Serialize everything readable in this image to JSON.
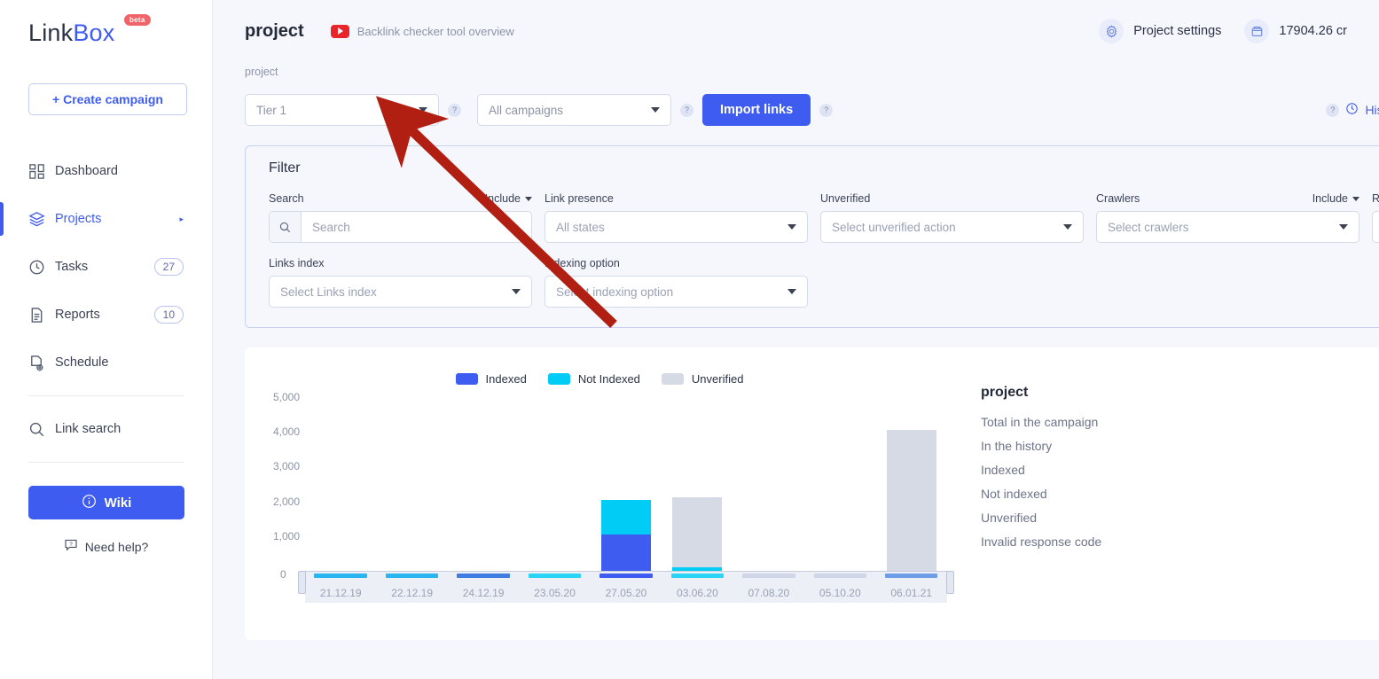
{
  "brand": {
    "name_dark": "Link",
    "name_blue": "Box",
    "badge": "beta"
  },
  "sidebar": {
    "create_button": "+ Create campaign",
    "items": [
      {
        "label": "Dashboard",
        "icon": "grid-icon",
        "badge": "",
        "caret": ""
      },
      {
        "label": "Projects",
        "icon": "layers-icon",
        "badge": "",
        "caret": "▸"
      },
      {
        "label": "Tasks",
        "icon": "clock-icon",
        "badge": "27",
        "caret": ""
      },
      {
        "label": "Reports",
        "icon": "document-icon",
        "badge": "10",
        "caret": ""
      },
      {
        "label": "Schedule",
        "icon": "schedule-icon",
        "badge": "",
        "caret": ""
      }
    ],
    "link_search": "Link search",
    "wiki_button": "Wiki",
    "need_help": "Need help?"
  },
  "header": {
    "project_title": "project",
    "video_link": "Backlink checker tool overview",
    "project_settings": "Project settings",
    "credits": "17904.26 cr",
    "breadcrumb": "project"
  },
  "toolbar": {
    "tier_value": "Tier 1",
    "campaign_value": "All campaigns",
    "import_button": "Import links",
    "history": "History",
    "help_mark": "?"
  },
  "filter": {
    "title": "Filter",
    "search_label": "Search",
    "search_placeholder": "Search",
    "include_label": "Include",
    "link_presence_label": "Link presence",
    "link_presence_value": "All states",
    "unverified_label": "Unverified",
    "unverified_value": "Select unverified action",
    "crawlers_label": "Crawlers",
    "crawlers_value": "Select crawlers",
    "crawlers_include": "Include",
    "clipped_label": "R",
    "links_index_label": "Links index",
    "links_index_value": "Select Links index",
    "indexing_option_label": "Indexing option",
    "indexing_option_value": "Select indexing option"
  },
  "stats": {
    "title": "project",
    "rows": [
      "Total in the campaign",
      "In the history",
      "Indexed",
      "Not indexed",
      "Unverified",
      "Invalid response code"
    ]
  },
  "colors": {
    "indexed": "#3f5cf0",
    "not_indexed": "#00ccf5",
    "unverified": "#d6dae4",
    "accent": "#3f5cf0",
    "arrow": "#b01f12"
  },
  "chart_data": {
    "type": "bar",
    "title": "",
    "xlabel": "",
    "ylabel": "",
    "ylim": [
      0,
      5000
    ],
    "yticks": [
      "0",
      "1,000",
      "2,000",
      "3,000",
      "4,000",
      "5,000"
    ],
    "ytick_values": [
      0,
      1000,
      2000,
      3000,
      4000,
      5000
    ],
    "grid": false,
    "legend_position": "top",
    "stacked": true,
    "categories": [
      "21.12.19",
      "22.12.19",
      "24.12.19",
      "23.05.20",
      "27.05.20",
      "03.06.20",
      "07.08.20",
      "05.10.20",
      "06.01.21"
    ],
    "series": [
      {
        "name": "Indexed",
        "color": "#3f5cf0",
        "values": [
          0,
          0,
          0,
          0,
          1050,
          0,
          0,
          0,
          0
        ]
      },
      {
        "name": "Not Indexed",
        "color": "#00ccf5",
        "values": [
          0,
          0,
          0,
          0,
          1000,
          110,
          0,
          0,
          0
        ]
      },
      {
        "name": "Unverified",
        "color": "#d6dae4",
        "values": [
          0,
          0,
          0,
          0,
          0,
          2000,
          0,
          0,
          4050
        ]
      }
    ],
    "navigator_thumbs": [
      "#29b6f0",
      "#29b6f0",
      "#3f7ee0",
      "#29d4f5",
      "#3f5cf0",
      "#29d4f5",
      "#cfd6e8",
      "#cfd6e8",
      "#6f9ee8"
    ]
  }
}
